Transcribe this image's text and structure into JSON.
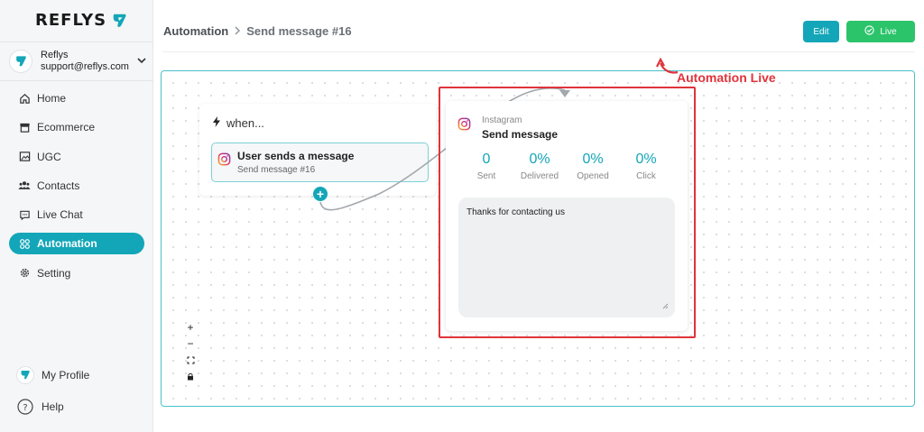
{
  "brand": {
    "name": "REFLYS",
    "accent": "#13a6b8"
  },
  "account": {
    "name": "Reflys",
    "email": "support@reflys.com"
  },
  "nav": {
    "items": [
      {
        "label": "Home",
        "icon": "home-icon"
      },
      {
        "label": "Ecommerce",
        "icon": "store-icon"
      },
      {
        "label": "UGC",
        "icon": "image-icon"
      },
      {
        "label": "Contacts",
        "icon": "users-icon"
      },
      {
        "label": "Live Chat",
        "icon": "chat-icon"
      },
      {
        "label": "Automation",
        "icon": "automation-icon",
        "active": true
      },
      {
        "label": "Setting",
        "icon": "gear-icon"
      }
    ],
    "profile": "My Profile",
    "help": "Help"
  },
  "header": {
    "breadcrumb_root": "Automation",
    "breadcrumb_separator": ">",
    "breadcrumb_current": "Send message #16",
    "edit_label": "Edit",
    "live_label": "Live"
  },
  "flow": {
    "when_label": "when...",
    "trigger_title": "User sends a message",
    "trigger_subtitle": "Send message #16",
    "message": {
      "type": "Instagram",
      "title": "Send message",
      "stats": [
        {
          "value": "0",
          "label": "Sent"
        },
        {
          "value": "0%",
          "label": "Delivered"
        },
        {
          "value": "0%",
          "label": "Opened"
        },
        {
          "value": "0%",
          "label": "Click"
        }
      ],
      "body": "Thanks for contacting us"
    }
  },
  "annotation": {
    "text": "Automation Live",
    "color": "#e0333b"
  },
  "zoom_controls": [
    "+",
    "−"
  ]
}
